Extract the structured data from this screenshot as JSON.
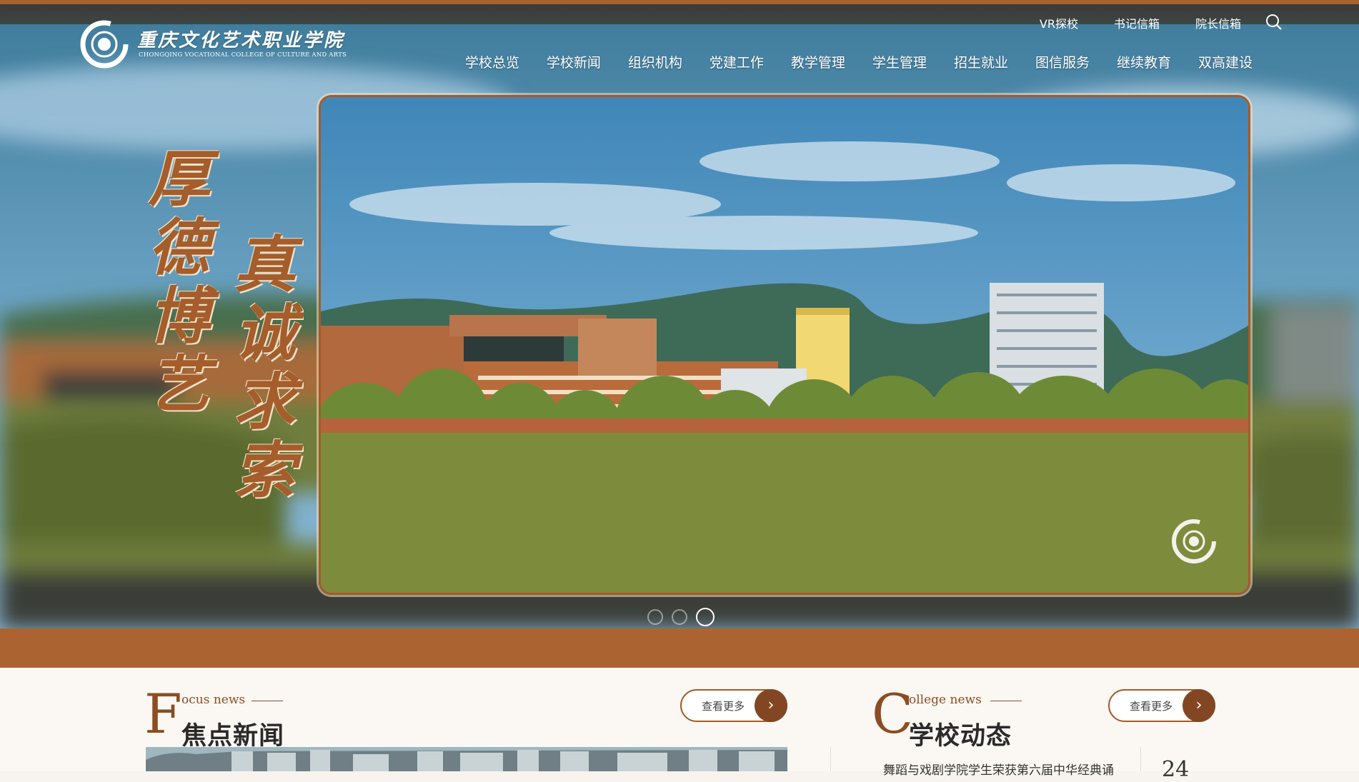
{
  "header": {
    "logo_cn": "重庆文化艺术职业学院",
    "logo_en": "CHONGQING VOCATIONAL COLLEGE OF CULTURE AND ARTS",
    "top_links": [
      "VR探校",
      "书记信箱",
      "院长信箱"
    ],
    "nav": [
      "学校总览",
      "学校新闻",
      "组织机构",
      "党建工作",
      "教学管理",
      "学生管理",
      "招生就业",
      "图信服务",
      "继续教育",
      "双高建设"
    ]
  },
  "banner": {
    "motto_col_1": "厚德博艺",
    "motto_col_2": "真诚求索",
    "slides_total": 3,
    "active_slide": 3
  },
  "sections": {
    "focus": {
      "letter": "F",
      "en": "ocus news",
      "cn": "焦点新闻",
      "more": "查看更多"
    },
    "college": {
      "letter": "C",
      "en": "ollege news",
      "cn": "学校动态",
      "more": "查看更多",
      "first_item_title": "舞蹈与戏剧学院学生荣获第六届中华经典诵",
      "first_item_day": "24"
    }
  },
  "colors": {
    "accent": "#a35b2a",
    "accent_dark": "#824722",
    "text_dark": "#2a2a2a"
  }
}
